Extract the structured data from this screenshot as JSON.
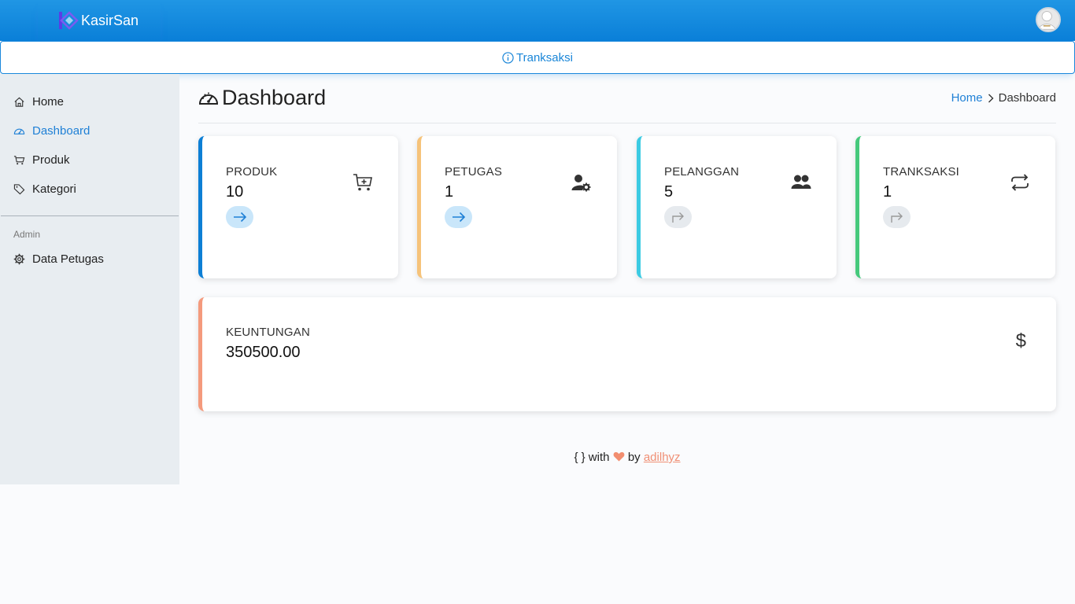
{
  "navbar": {
    "brand": "KasirSan"
  },
  "notice": {
    "label": "Tranksaksi"
  },
  "sidebar": {
    "items": [
      {
        "label": "Home",
        "icon": "home-icon"
      },
      {
        "label": "Dashboard",
        "icon": "dashboard-icon",
        "active": true
      },
      {
        "label": "Produk",
        "icon": "cart-icon"
      },
      {
        "label": "Kategori",
        "icon": "tag-icon"
      }
    ],
    "admin_heading": "Admin",
    "admin_items": [
      {
        "label": "Data Petugas",
        "icon": "gear-icon"
      }
    ]
  },
  "page": {
    "title": "Dashboard",
    "breadcrumb": {
      "home": "Home",
      "current": "Dashboard"
    }
  },
  "cards": [
    {
      "title": "PRODUK",
      "value": "10",
      "icon": "cart-plus-icon",
      "accent": "#0d7fd5",
      "button": "arrow-right-icon"
    },
    {
      "title": "PETUGAS",
      "value": "1",
      "icon": "user-gear-icon",
      "accent": "#f6c37a",
      "button": "arrow-right-icon"
    },
    {
      "title": "PELANGGAN",
      "value": "5",
      "icon": "users-icon",
      "accent": "#3ccbe3",
      "button": "share-arrow-icon"
    },
    {
      "title": "TRANKSAKSI",
      "value": "1",
      "icon": "repeat-icon",
      "accent": "#45c97c",
      "button": "share-arrow-icon"
    }
  ],
  "profit": {
    "title": "KEUNTUNGAN",
    "value": "350500.00",
    "symbol": "$",
    "accent": "#f49a7d"
  },
  "footer": {
    "prefix": "{ } with",
    "by": "by",
    "author": "adilhyz"
  }
}
